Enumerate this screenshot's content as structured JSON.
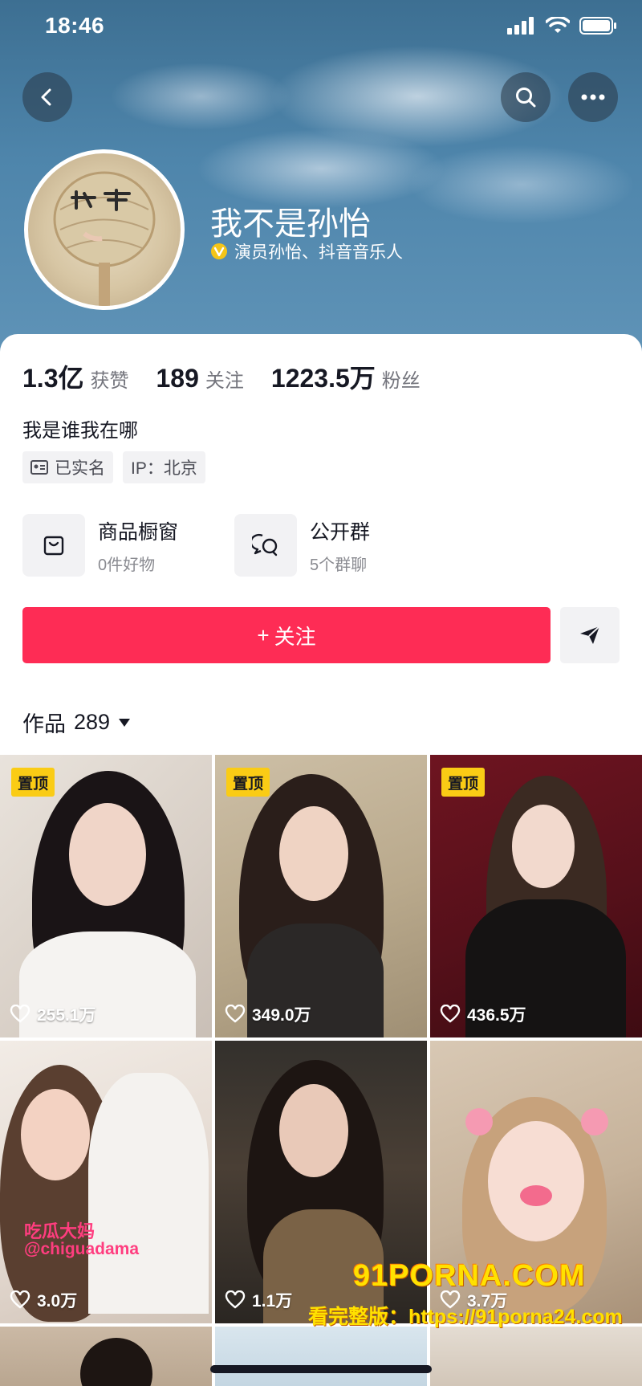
{
  "status_bar": {
    "time": "18:46"
  },
  "profile": {
    "nickname": "我不是孙怡",
    "verification": "演员孙怡、抖音音乐人",
    "bio": "我是谁我在哪"
  },
  "stats": [
    {
      "value": "1.3亿",
      "label": "获赞"
    },
    {
      "value": "189",
      "label": "关注"
    },
    {
      "value": "1223.5万",
      "label": "粉丝"
    }
  ],
  "tags": {
    "real_name": "已实名",
    "ip": "IP：北京"
  },
  "features": [
    {
      "title": "商品橱窗",
      "subtitle": "0件好物",
      "icon": "shop-bag-icon"
    },
    {
      "title": "公开群",
      "subtitle": "5个群聊",
      "icon": "group-chat-icon"
    }
  ],
  "actions": {
    "follow_label": "关注",
    "follow_prefix": "+"
  },
  "works_tab": {
    "label": "作品",
    "count": "289"
  },
  "videos": [
    {
      "pinned": true,
      "pin_label": "置顶",
      "likes": "255.1万"
    },
    {
      "pinned": true,
      "pin_label": "置顶",
      "likes": "349.0万"
    },
    {
      "pinned": true,
      "pin_label": "置顶",
      "likes": "436.5万"
    },
    {
      "pinned": false,
      "likes": "3.0万",
      "overlay_title": "吃瓜大妈",
      "overlay_handle": "@chiguadama"
    },
    {
      "pinned": false,
      "likes": "1.1万"
    },
    {
      "pinned": false,
      "likes": "3.7万"
    }
  ],
  "watermark": {
    "logo": "91PORNA.COM",
    "url": "看完整版：https://91porna24.com"
  },
  "colors": {
    "accent": "#fe2c55",
    "pin_badge": "#facc15",
    "verify": "#f5c518"
  }
}
